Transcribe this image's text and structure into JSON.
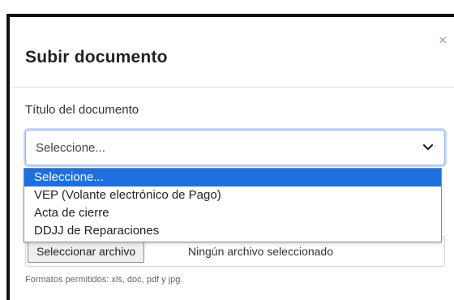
{
  "modal": {
    "title": "Subir documento",
    "close_label": "×"
  },
  "form": {
    "field_label": "Título del documento",
    "select_value": "Seleccione...",
    "options": [
      "Seleccione...",
      "VEP (Volante electrónico de Pago)",
      "Acta de cierre",
      "DDJJ de Reparaciones"
    ],
    "selected_option_index": 0,
    "file_button_label": "Seleccionar archivo",
    "file_status": "Ningún archivo seleccionado",
    "help_text": "Formatos permitidos: xls, doc, pdf y jpg."
  },
  "colors": {
    "highlight": "#1e6fe0",
    "focus_border": "#8fb6f0"
  },
  "icons": {
    "close": "close-icon",
    "chevron": "chevron-down-icon"
  }
}
